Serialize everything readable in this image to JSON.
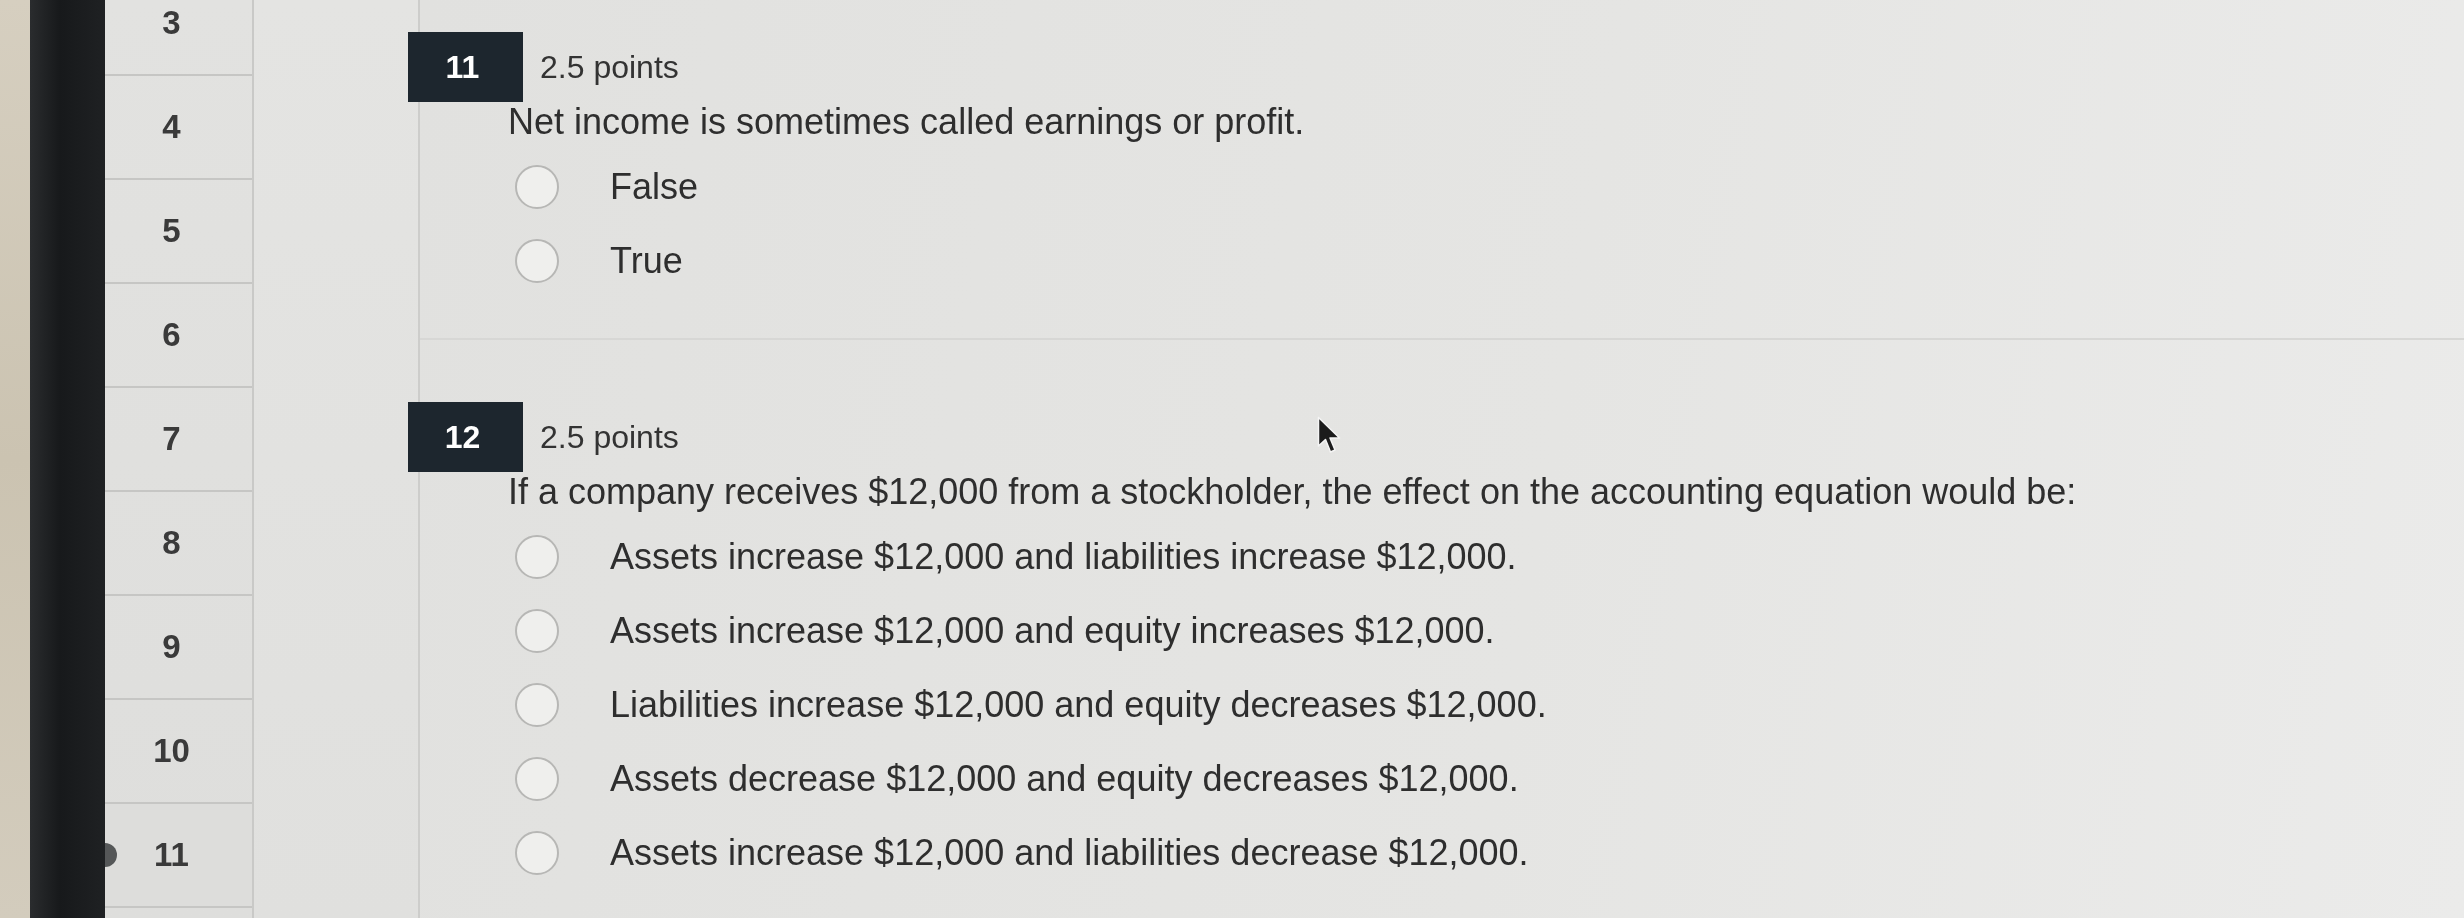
{
  "question_nav": {
    "items": [
      {
        "label": "3",
        "selected": false
      },
      {
        "label": "4",
        "selected": false
      },
      {
        "label": "5",
        "selected": false
      },
      {
        "label": "6",
        "selected": false
      },
      {
        "label": "7",
        "selected": false
      },
      {
        "label": "8",
        "selected": false
      },
      {
        "label": "9",
        "selected": false
      },
      {
        "label": "10",
        "selected": false
      },
      {
        "label": "11",
        "selected": true
      }
    ]
  },
  "questions": [
    {
      "number": "11",
      "points": "2.5 points",
      "prompt": "Net income is sometimes called earnings or profit.",
      "options": [
        {
          "label": "False",
          "selected": false
        },
        {
          "label": "True",
          "selected": false
        }
      ]
    },
    {
      "number": "12",
      "points": "2.5 points",
      "prompt": "If a company receives $12,000 from a stockholder, the effect on the accounting equation would be:",
      "options": [
        {
          "label": "Assets increase $12,000 and liabilities increase $12,000.",
          "selected": false
        },
        {
          "label": "Assets increase $12,000 and equity increases $12,000.",
          "selected": false
        },
        {
          "label": "Liabilities increase $12,000 and equity decreases $12,000.",
          "selected": false
        },
        {
          "label": "Assets decrease $12,000 and equity decreases $12,000.",
          "selected": false
        },
        {
          "label": "Assets increase $12,000 and liabilities decrease $12,000.",
          "selected": false
        }
      ]
    }
  ]
}
